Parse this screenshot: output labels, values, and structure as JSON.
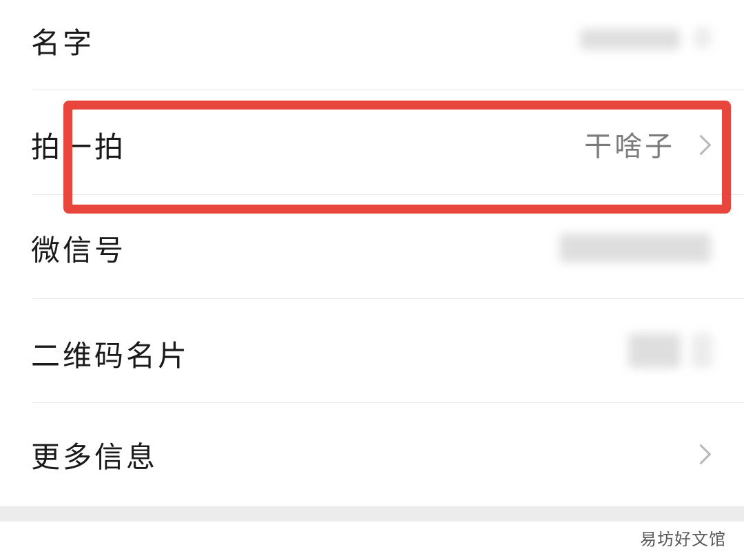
{
  "profile_menu": {
    "items": [
      {
        "label": "名字",
        "value": ""
      },
      {
        "label": "拍一拍",
        "value": "干啥子"
      },
      {
        "label": "微信号",
        "value": ""
      },
      {
        "label": "二维码名片",
        "value": ""
      },
      {
        "label": "更多信息",
        "value": ""
      }
    ]
  },
  "watermark": "易坊好文馆",
  "colors": {
    "highlight": "#e8453c",
    "chevron": "#b8b8b8",
    "label": "#1a1a1a",
    "value": "#7a7a7a"
  },
  "icons": [
    "chevron-right-icon"
  ]
}
